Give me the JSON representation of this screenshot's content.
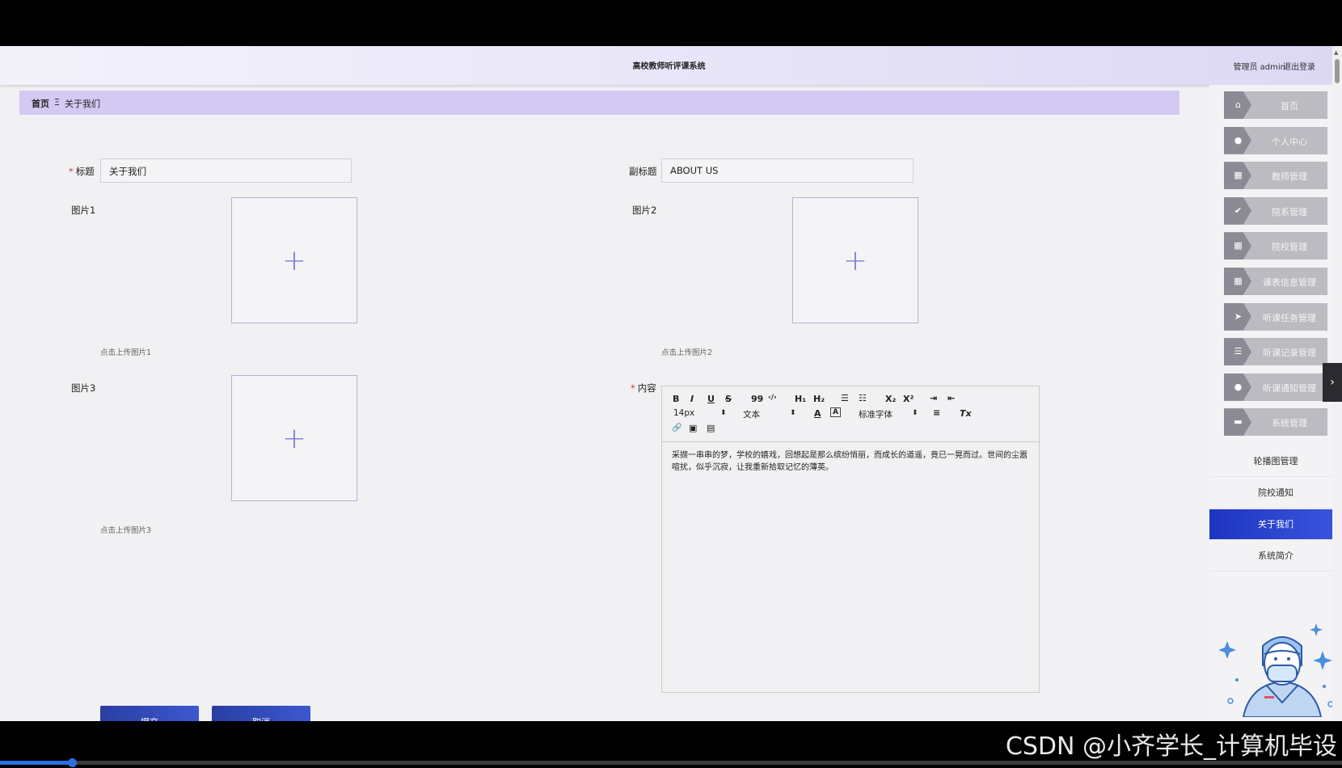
{
  "header": {
    "title": "高校教师听评课系统",
    "user": "管理员 admin",
    "logout": "退出登录"
  },
  "breadcrumb": {
    "home": "首页",
    "separator": "Ξ",
    "current": "关于我们"
  },
  "form": {
    "required_mark": "*",
    "title_label": "标题",
    "title_value": "关于我们",
    "subtitle_label": "副标题",
    "subtitle_value": "ABOUT US",
    "image1_label": "图片1",
    "image1_hint": "点击上传图片1",
    "image2_label": "图片2",
    "image2_hint": "点击上传图片2",
    "image3_label": "图片3",
    "image3_hint": "点击上传图片3",
    "content_label": "内容",
    "upload_icon": "+",
    "submit": "提交",
    "cancel": "取消"
  },
  "editor": {
    "toolbar": {
      "bold": "B",
      "italic": "I",
      "underline": "U",
      "strike": "S",
      "quote": "99",
      "code": "‹/›",
      "h1": "H₁",
      "h2": "H₂",
      "ordered_list": "☰",
      "bullet_list": "☷",
      "subscript": "X₂",
      "superscript": "X²",
      "indent": "⇥",
      "outdent": "⇤",
      "size": "14px",
      "header": "文本",
      "font_color": "A",
      "bg_color": "A",
      "font_family": "标准字体",
      "align": "≡",
      "clean": "Tx",
      "link": "🔗",
      "image": "▣",
      "video": "▤"
    },
    "content": "采撷一串串的梦，学校的嬉戏，回想起是那么缤纷悄丽，而成长的道遥，竟已一晃而过。世间的尘嚣喧扰，似乎沉寂，让我重新拾取记忆的薄英。"
  },
  "sidebar": {
    "menu": [
      {
        "label": "首页",
        "icon": "home-icon",
        "glyph": "⌂"
      },
      {
        "label": "个人中心",
        "icon": "user-icon",
        "glyph": "●"
      },
      {
        "label": "教师管理",
        "icon": "grid-icon",
        "glyph": "▦"
      },
      {
        "label": "院系管理",
        "icon": "check-icon",
        "glyph": "✔"
      },
      {
        "label": "院校管理",
        "icon": "grid-icon",
        "glyph": "▦"
      },
      {
        "label": "课表信息管理",
        "icon": "grid-icon",
        "glyph": "▦"
      },
      {
        "label": "听课任务管理",
        "icon": "send-icon",
        "glyph": "➤"
      },
      {
        "label": "听课记录管理",
        "icon": "list-icon",
        "glyph": "☰"
      },
      {
        "label": "听课通知管理",
        "icon": "user-icon",
        "glyph": "●"
      },
      {
        "label": "系统管理",
        "icon": "chat-icon",
        "glyph": "▬"
      }
    ],
    "submenu": [
      {
        "label": "轮播图管理",
        "active": false
      },
      {
        "label": "院校通知",
        "active": false
      },
      {
        "label": "关于我们",
        "active": true
      },
      {
        "label": "系统简介",
        "active": false
      }
    ]
  },
  "watermark": "CSDN @小齐学长_计算机毕设",
  "expand_icon": "›",
  "colors": {
    "accent": "#2a3da3",
    "breadcrumb_bg": "#d3c9f2",
    "required": "#d0393a",
    "active_menu": "#1e34c0"
  }
}
